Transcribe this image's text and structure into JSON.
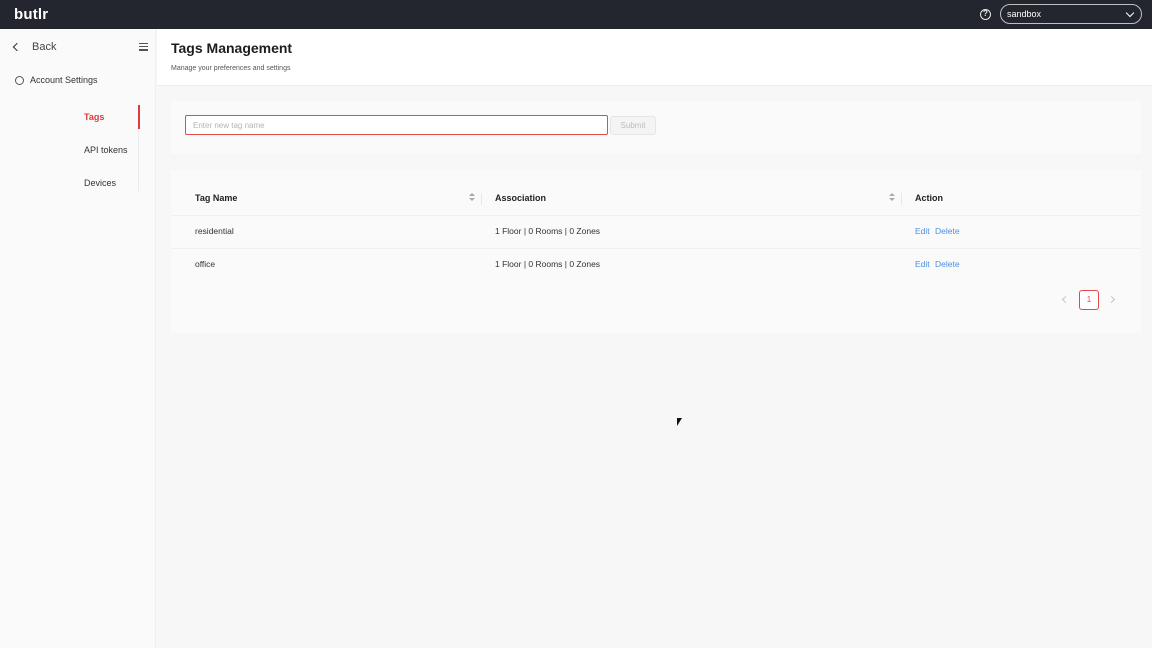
{
  "topbar": {
    "logo": "butlr",
    "environment": "sandbox",
    "help_glyph": "?"
  },
  "sidebar": {
    "back_label": "Back",
    "section_label": "Account Settings",
    "items": [
      {
        "label": "Tags",
        "active": true
      },
      {
        "label": "API tokens",
        "active": false
      },
      {
        "label": "Devices",
        "active": false
      }
    ]
  },
  "header": {
    "title": "Tags Management",
    "subtitle": "Manage your preferences and settings"
  },
  "tag_form": {
    "placeholder": "Enter new tag name",
    "value": "",
    "submit_label": "Submit"
  },
  "table": {
    "columns": [
      "Tag Name",
      "Association",
      "Action"
    ],
    "rows": [
      {
        "name": "residential",
        "association": "1 Floor | 0 Rooms | 0 Zones",
        "edit": "Edit",
        "delete": "Delete"
      },
      {
        "name": "office",
        "association": "1 Floor | 0 Rooms | 0 Zones",
        "edit": "Edit",
        "delete": "Delete"
      }
    ]
  },
  "pagination": {
    "current_page": "1"
  },
  "colors": {
    "topbar": "#23262e",
    "accent": "#e34a4a",
    "link": "#4a90e2"
  }
}
